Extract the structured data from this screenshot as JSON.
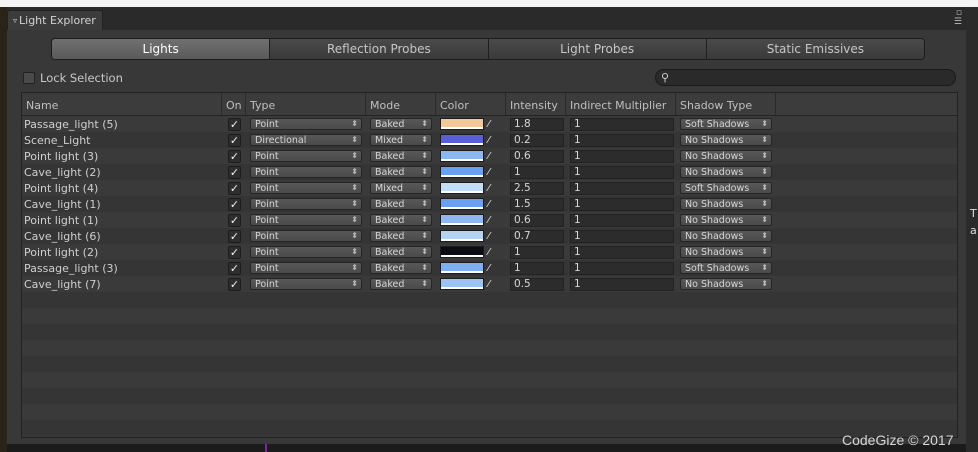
{
  "window": {
    "tab_title": "Light Explorer"
  },
  "tabs": [
    "Lights",
    "Reflection Probes",
    "Light Probes",
    "Static Emissives"
  ],
  "active_tab": 0,
  "lock_selection": {
    "label": "Lock Selection",
    "checked": false
  },
  "search": {
    "placeholder": ""
  },
  "columns": [
    "Name",
    "On",
    "Type",
    "Mode",
    "Color",
    "Intensity",
    "Indirect Multiplier",
    "Shadow Type"
  ],
  "rows": [
    {
      "name": "Passage_light (5)",
      "on": true,
      "type": "Point",
      "mode": "Baked",
      "color": "#f2c79b",
      "intensity": "1.8",
      "indirect": "1",
      "shadow": "Soft Shadows"
    },
    {
      "name": "Scene_Light",
      "on": true,
      "type": "Directional",
      "mode": "Mixed",
      "color": "#5a5fd8",
      "intensity": "0.2",
      "indirect": "1",
      "shadow": "No Shadows"
    },
    {
      "name": "Point light (3)",
      "on": true,
      "type": "Point",
      "mode": "Baked",
      "color": "#8cb8f0",
      "intensity": "0.6",
      "indirect": "1",
      "shadow": "No Shadows"
    },
    {
      "name": "Cave_light (2)",
      "on": true,
      "type": "Point",
      "mode": "Baked",
      "color": "#6b9ff0",
      "intensity": "1",
      "indirect": "1",
      "shadow": "No Shadows"
    },
    {
      "name": "Point light (4)",
      "on": true,
      "type": "Point",
      "mode": "Mixed",
      "color": "#c3ddf7",
      "intensity": "2.5",
      "indirect": "1",
      "shadow": "Soft Shadows"
    },
    {
      "name": "Cave_light (1)",
      "on": true,
      "type": "Point",
      "mode": "Baked",
      "color": "#6d9ff0",
      "intensity": "1.5",
      "indirect": "1",
      "shadow": "No Shadows"
    },
    {
      "name": "Point light (1)",
      "on": true,
      "type": "Point",
      "mode": "Baked",
      "color": "#8fb8f0",
      "intensity": "0.6",
      "indirect": "1",
      "shadow": "No Shadows"
    },
    {
      "name": "Cave_light (6)",
      "on": true,
      "type": "Point",
      "mode": "Baked",
      "color": "#b5d2f3",
      "intensity": "0.7",
      "indirect": "1",
      "shadow": "No Shadows"
    },
    {
      "name": "Point light (2)",
      "on": true,
      "type": "Point",
      "mode": "Baked",
      "color": "#0a0c14",
      "intensity": "1",
      "indirect": "1",
      "shadow": "No Shadows"
    },
    {
      "name": "Passage_light (3)",
      "on": true,
      "type": "Point",
      "mode": "Baked",
      "color": "#7eaff0",
      "intensity": "1",
      "indirect": "1",
      "shadow": "Soft Shadows"
    },
    {
      "name": "Cave_light (7)",
      "on": true,
      "type": "Point",
      "mode": "Baked",
      "color": "#9cc4f2",
      "intensity": "0.5",
      "indirect": "1",
      "shadow": "No Shadows"
    }
  ],
  "empty_row_count": 9,
  "watermark": "CodeGize © 2017",
  "side_letters": [
    "T",
    "a"
  ]
}
